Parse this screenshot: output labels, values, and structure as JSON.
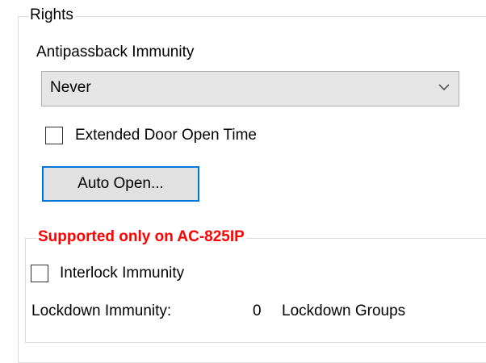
{
  "rights": {
    "title": "Rights",
    "antipassback_label": "Antipassback Immunity",
    "antipassback_value": "Never",
    "extended_door_open_label": "Extended Door Open Time",
    "extended_door_open_checked": false,
    "auto_open_button": "Auto Open..."
  },
  "supported": {
    "title": "Supported only on AC-825IP",
    "title_color": "#ff0000",
    "interlock_label": "Interlock Immunity",
    "interlock_checked": false,
    "lockdown_label": "Lockdown Immunity:",
    "lockdown_count": "0",
    "lockdown_groups_label": "Lockdown Groups"
  },
  "icons": {
    "combo_arrow": "chevron-down-icon"
  },
  "colors": {
    "button_focus_border": "#0078d7",
    "combo_background": "#e6e6e6"
  }
}
